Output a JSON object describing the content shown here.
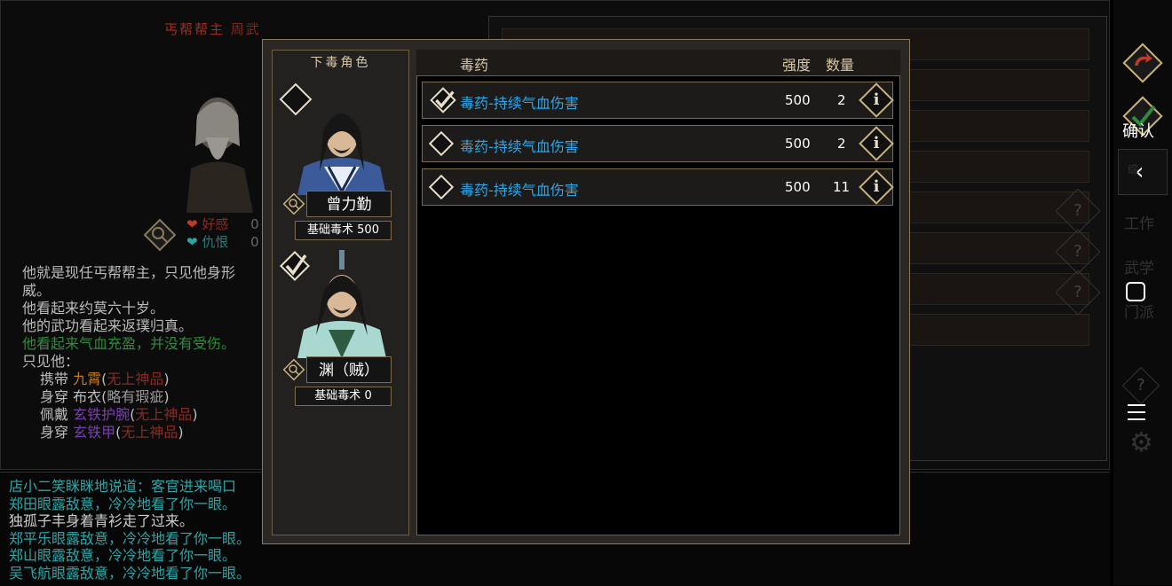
{
  "background": {
    "npc_title_red": "丐帮帮主",
    "npc_title_name": "周武",
    "affection_label": "好感",
    "affection_value": "0",
    "hatred_label": "仇恨",
    "hatred_value": "0",
    "description_lines": [
      {
        "text": "他就是现任丐帮帮主，只见他身形",
        "color": "#bbbbbb"
      },
      {
        "text": "威。",
        "color": "#bbbbbb"
      },
      {
        "text": "他看起来约莫六十岁。",
        "color": "#bbbbbb"
      },
      {
        "text": "他的武功看起来返璞归真。",
        "color": "#bbbbbb"
      },
      {
        "text": "他看起来气血充盈，并没有受伤。",
        "color": "#2e8b3e"
      },
      {
        "text": "只见他：",
        "color": "#bbbbbb"
      }
    ],
    "equipment": [
      {
        "slot": "携带",
        "item": "九霄",
        "grade": "无上神品",
        "item_color": "#c87b1e"
      },
      {
        "slot": "身穿",
        "item": "布衣",
        "grade": "略有瑕疵",
        "item_color": "#bbbbbb"
      },
      {
        "slot": "佩戴",
        "item": "玄铁护腕",
        "grade": "无上神品",
        "item_color": "#8a3fb8"
      },
      {
        "slot": "身穿",
        "item": "玄铁甲",
        "grade": "无上神品",
        "item_color": "#8a3fb8"
      }
    ],
    "log_lines": [
      {
        "text": "店小二笑眯眯地说道：客官进来喝口",
        "color": "#2ea5a5"
      },
      {
        "text": "郑田眼露敌意，冷冷地看了你一眼。",
        "color": "#2ea5a5"
      },
      {
        "text": "独孤子丰身着青衫走了过来。",
        "color": "#cccccc"
      },
      {
        "text": "郑平乐眼露敌意，冷冷地看了你一眼。",
        "color": "#2ea5a5"
      },
      {
        "text": "郑山眼露敌意，冷冷地看了你一眼。",
        "color": "#2ea5a5"
      },
      {
        "text": "吴飞航眼露敌意，冷冷地看了你一眼。",
        "color": "#2ea5a5"
      }
    ],
    "side_buttons": {
      "confirm": "确认",
      "back_icon": "chevron-left-icon",
      "menu_labels": [
        "综",
        "工作",
        "武学",
        "门派"
      ]
    }
  },
  "modal": {
    "left_header": "下毒角色",
    "characters": [
      {
        "name": "曾力勤",
        "skill_label": "基础毒术",
        "skill_value": "500",
        "selected": false
      },
      {
        "name": "渊（贼）",
        "skill_label": "基础毒术",
        "skill_value": "0",
        "selected": true
      }
    ],
    "columns": {
      "poison": "毒药",
      "strength": "强度",
      "count": "数量"
    },
    "poisons": [
      {
        "name": "毒药-持续气血伤害",
        "strength": "500",
        "count": "2",
        "selected": true
      },
      {
        "name": "毒药-持续气血伤害",
        "strength": "500",
        "count": "2",
        "selected": false
      },
      {
        "name": "毒药-持续气血伤害",
        "strength": "500",
        "count": "11",
        "selected": false
      }
    ],
    "info_glyph": "i"
  }
}
